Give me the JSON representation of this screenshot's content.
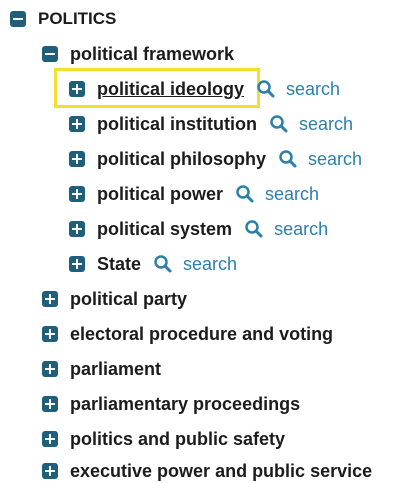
{
  "root": {
    "label": "POLITICS"
  },
  "framework": {
    "label": "political framework"
  },
  "framework_children": [
    {
      "label": "political ideology",
      "search": "search"
    },
    {
      "label": "political institution",
      "search": "search"
    },
    {
      "label": "political philosophy",
      "search": "search"
    },
    {
      "label": "political power",
      "search": "search"
    },
    {
      "label": "political system",
      "search": "search"
    },
    {
      "label": "State",
      "search": "search"
    }
  ],
  "siblings": [
    {
      "label": "political party"
    },
    {
      "label": "electoral procedure and voting"
    },
    {
      "label": "parliament"
    },
    {
      "label": "parliamentary proceedings"
    },
    {
      "label": "politics and public safety"
    },
    {
      "label": "executive power and public service"
    }
  ],
  "colors": {
    "toggle": "#1f5f7c",
    "link": "#2a80ab",
    "highlight": "#f2e030"
  },
  "icons": {
    "expanded": "minus-square-icon",
    "collapsed": "plus-square-icon",
    "search": "magnifier-icon"
  }
}
